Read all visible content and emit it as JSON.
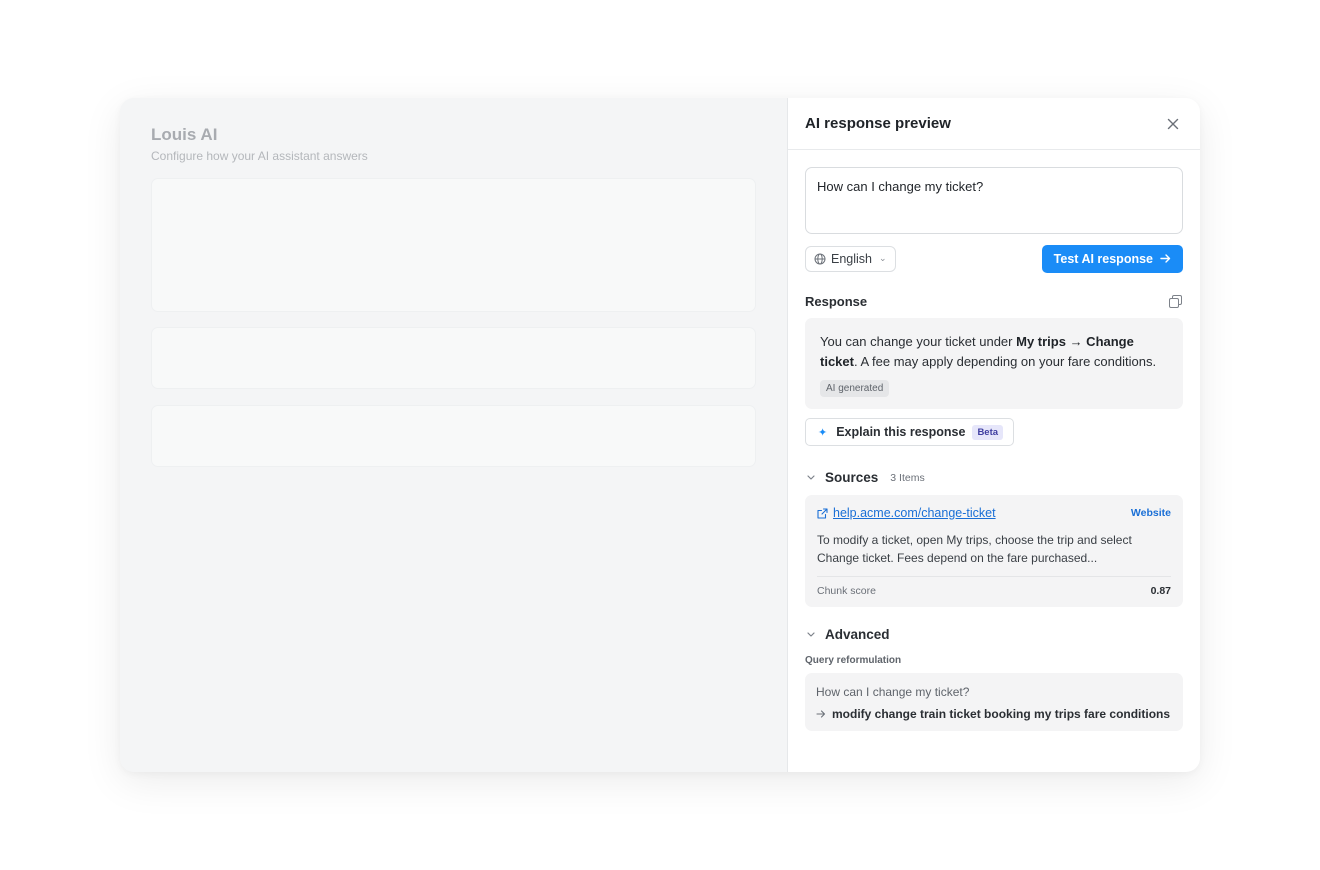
{
  "background_app": {
    "title": "Louis AI",
    "subtitle": "Configure how your AI assistant answers"
  },
  "panel": {
    "title": "AI response preview",
    "close_icon": "close-icon",
    "question_value": "How can I change my ticket?",
    "language": "English",
    "test_button_label": "Test AI response",
    "response": {
      "label": "Response",
      "text_before": "You can change your ticket under ",
      "text_bold": "My trips → Change ticket",
      "text_after": ". A fee may apply depending on your fare conditions.",
      "badge": "AI generated"
    },
    "explain": {
      "label": "Explain this response",
      "badge": "Beta"
    },
    "sources": {
      "title": "Sources",
      "count": "3 Items",
      "items": [
        {
          "url": "help.acme.com/change-ticket",
          "type": "Website",
          "excerpt": "To modify a ticket, open My trips, choose the trip and select Change ticket. Fees depend on the fare purchased...",
          "score_label": "Chunk score",
          "score": "0.87"
        }
      ]
    },
    "advanced": {
      "title": "Advanced",
      "query_label": "Query reformulation",
      "original_query": "How can I change my ticket?",
      "reformulated_query": "modify change train ticket booking my trips fare conditions"
    }
  },
  "colors": {
    "accent": "#1a8cf7",
    "link": "#1a6fd6",
    "beta_bg": "#e6e6fa",
    "beta_text": "#3f3ea0"
  }
}
